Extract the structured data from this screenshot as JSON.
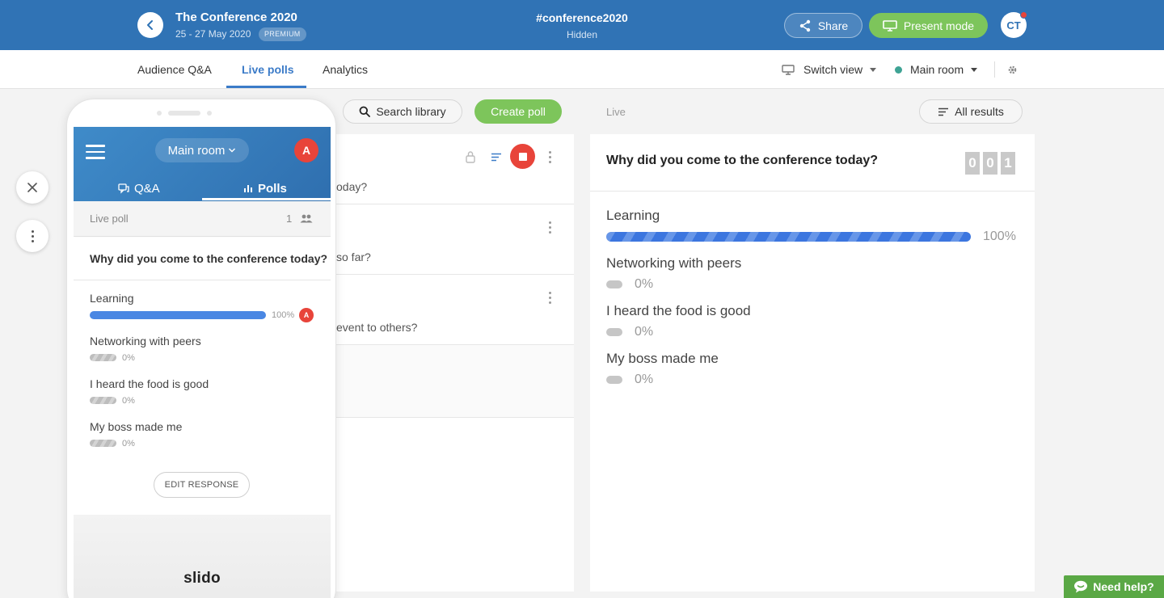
{
  "header": {
    "event_title": "The Conference 2020",
    "event_dates": "25 - 27 May 2020",
    "plan_badge": "PREMIUM",
    "hashtag": "#conference2020",
    "visibility": "Hidden",
    "share_label": "Share",
    "present_label": "Present mode",
    "user_initials": "CT",
    "brand_color": "#3073b5"
  },
  "nav": {
    "tabs": [
      {
        "label": "Audience Q&A"
      },
      {
        "label": "Live polls"
      },
      {
        "label": "Analytics"
      }
    ],
    "active_tab": "Live polls",
    "switch_view_label": "Switch view",
    "room_label": "Main room",
    "settings_icon": "gear-icon"
  },
  "toolbar": {
    "search_label": "Search library",
    "create_label": "Create poll",
    "live_label": "Live",
    "all_results_label": "All results"
  },
  "poll_list": {
    "rows": [
      {
        "text": "oday?"
      },
      {
        "text": "so far?"
      },
      {
        "text": "event to others?"
      }
    ]
  },
  "results": {
    "question": "Why did you come to the conference today?",
    "counter_digits": [
      "0",
      "0",
      "1"
    ],
    "options": [
      {
        "label": "Learning",
        "percent": "100%",
        "fraction": 1.0
      },
      {
        "label": "Networking with peers",
        "percent": "0%",
        "fraction": 0
      },
      {
        "label": "I heard the food is good",
        "percent": "0%",
        "fraction": 0
      },
      {
        "label": "My boss made me",
        "percent": "0%",
        "fraction": 0
      }
    ]
  },
  "phone": {
    "room_label": "Main room",
    "avatar_initial": "A",
    "tab_qa": "Q&A",
    "tab_polls": "Polls",
    "live_poll_label": "Live poll",
    "participant_count": "1",
    "question": "Why did you come to the conference today?",
    "options": [
      {
        "label": "Learning",
        "percent": "100%",
        "fraction": 1.0
      },
      {
        "label": "Networking with peers",
        "percent": "0%",
        "fraction": 0
      },
      {
        "label": "I heard the food is good",
        "percent": "0%",
        "fraction": 0
      },
      {
        "label": "My boss made me",
        "percent": "0%",
        "fraction": 0
      }
    ],
    "voter_initial": "A",
    "edit_label": "EDIT RESPONSE",
    "logo": "slido"
  },
  "help": {
    "label": "Need help?"
  }
}
